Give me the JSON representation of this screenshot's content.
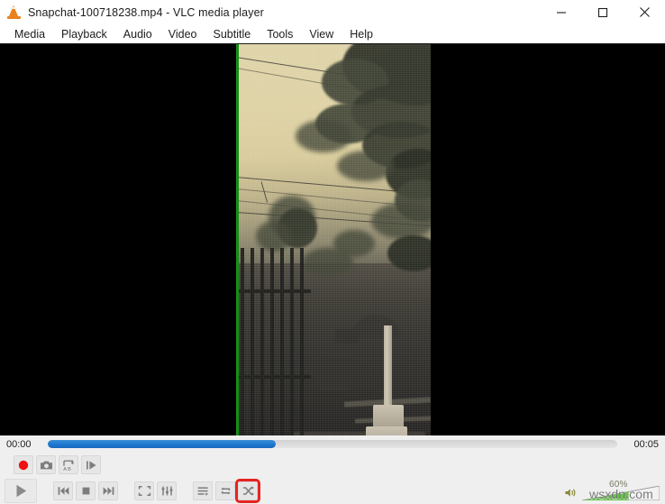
{
  "window": {
    "title": "Snapchat-100718238.mp4 - VLC media player",
    "app_icon": "vlc-cone-icon",
    "controls": {
      "minimize": "minimize-icon",
      "maximize": "maximize-icon",
      "close": "close-icon"
    }
  },
  "menubar": {
    "items": [
      {
        "label": "Media"
      },
      {
        "label": "Playback"
      },
      {
        "label": "Audio"
      },
      {
        "label": "Video"
      },
      {
        "label": "Subtitle"
      },
      {
        "label": "Tools"
      },
      {
        "label": "View"
      },
      {
        "label": "Help"
      }
    ]
  },
  "video": {
    "description": "Sepia-toned hazy outdoor video of trees, power lines, a metal gate and a roadside marker post",
    "aspect": "portrait",
    "letterbox_color": "#000000",
    "selection_edge_color": "#0b8a0b"
  },
  "seekbar": {
    "elapsed": "00:00",
    "total": "00:05",
    "progress_percent": 40,
    "fill_color": "#1f7ad1",
    "track_color": "#dcdcdc"
  },
  "advanced_controls": [
    {
      "name": "record-button",
      "icon": "record-icon",
      "label": "Record"
    },
    {
      "name": "snapshot-button",
      "icon": "camera-icon",
      "label": "Take snapshot"
    },
    {
      "name": "ab-loop-button",
      "icon": "ab-loop-icon",
      "label": "A to B loop"
    },
    {
      "name": "frame-by-frame-button",
      "icon": "frame-step-icon",
      "label": "Frame by frame"
    }
  ],
  "main_controls": [
    {
      "name": "play-button",
      "icon": "play-icon",
      "label": "Play"
    },
    {
      "name": "previous-button",
      "icon": "previous-icon",
      "label": "Previous media"
    },
    {
      "name": "stop-button",
      "icon": "stop-icon",
      "label": "Stop playback"
    },
    {
      "name": "next-button",
      "icon": "next-icon",
      "label": "Next media"
    },
    {
      "name": "fullscreen-button",
      "icon": "fullscreen-icon",
      "label": "Toggle fullscreen"
    },
    {
      "name": "extended-settings-button",
      "icon": "equalizer-icon",
      "label": "Show extended settings"
    },
    {
      "name": "playlist-button",
      "icon": "playlist-icon",
      "label": "Show playlist"
    },
    {
      "name": "loop-button",
      "icon": "loop-icon",
      "label": "Click to toggle between loop all, loop one and no loop"
    },
    {
      "name": "random-button",
      "icon": "shuffle-icon",
      "label": "Random",
      "highlighted": true,
      "highlight_color": "#e52421"
    }
  ],
  "volume": {
    "icon": "speaker-icon",
    "level_text": "60%",
    "level_percent": 60,
    "fill_color": "#6cbf52"
  },
  "watermark": {
    "text": "wsxdn.com"
  }
}
